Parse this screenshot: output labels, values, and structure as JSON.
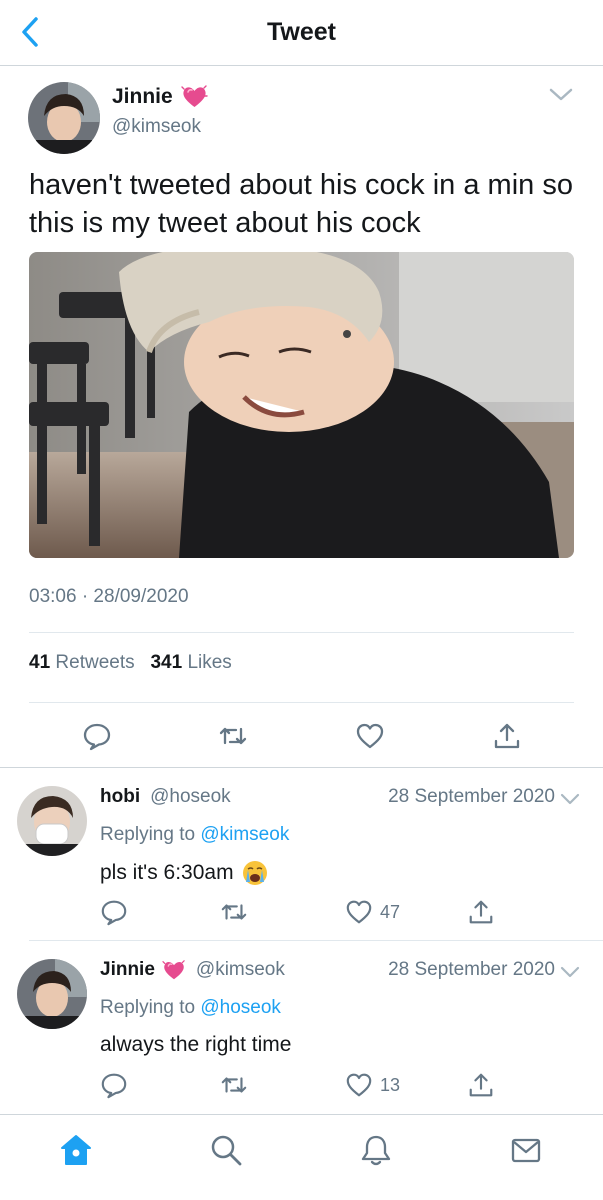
{
  "header": {
    "title": "Tweet",
    "back_icon": "chevron-left-icon"
  },
  "main_tweet": {
    "author_name": "Jinnie",
    "author_handle": "@kimseok",
    "author_emoji": "pink-sparkling-heart",
    "text": "haven't tweeted about his cock in a min so this is my tweet about his cock",
    "timestamp": "03:06 · 28/09/2020",
    "retweet_count": "41",
    "retweet_label": "Retweets",
    "like_count": "341",
    "like_label": "Likes",
    "actions": [
      "reply-icon",
      "retweet-icon",
      "like-icon",
      "share-icon"
    ]
  },
  "replies": [
    {
      "author_name": "hobi",
      "author_handle": "@hoseok",
      "date": "28 September 2020",
      "replying_prefix": "Replying to",
      "replying_to": "@kimseok",
      "text": "pls it's 6:30am",
      "emoji": "loudly-crying-face",
      "like_count": "47"
    },
    {
      "author_name": "Jinnie",
      "author_handle": "@kimseok",
      "date": "28 September 2020",
      "replying_prefix": "Replying to",
      "replying_to": "@hoseok",
      "text": "always the right time",
      "like_count": "13"
    }
  ],
  "tabbar": {
    "tabs": [
      "home-icon",
      "search-icon",
      "notifications-icon",
      "messages-icon"
    ],
    "active": "home-icon"
  },
  "colors": {
    "accent": "#1da1f2",
    "secondary_text": "#657786",
    "primary_text": "#14171a",
    "divider": "#e1e8ed",
    "heart_emoji": "#e64b8f"
  }
}
